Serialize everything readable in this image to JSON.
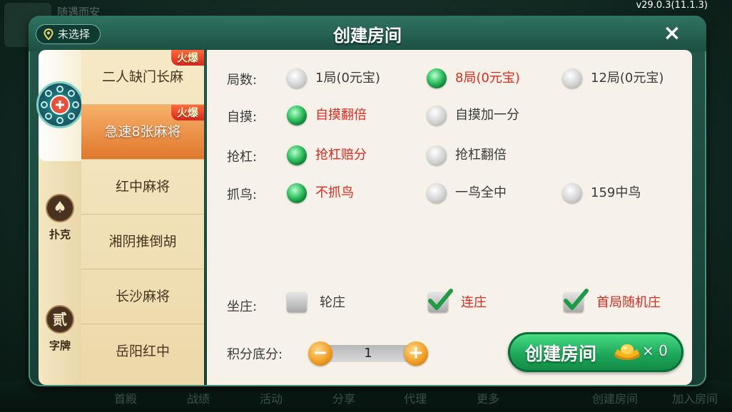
{
  "version": "v29.0.3(11.1.3)",
  "background": {
    "top_text": "随遇而安",
    "bottom_items": [
      "首殿",
      "战绩",
      "活动",
      "分享",
      "代理",
      "更多",
      "创建房间",
      "加入房间"
    ]
  },
  "dialog": {
    "title": "创建房间",
    "location_label": "未选择",
    "close_label": "×"
  },
  "categories": [
    {
      "name": "mahjong",
      "label": "",
      "active": true
    },
    {
      "name": "poker",
      "label": "扑克",
      "glyph": "♠"
    },
    {
      "name": "zipai",
      "label": "字牌",
      "glyph": "贰"
    }
  ],
  "games": [
    {
      "label": "二人缺门长麻",
      "hot": "火爆",
      "selected": false
    },
    {
      "label": "急速8张麻将",
      "hot": "火爆",
      "selected": true
    },
    {
      "label": "红中麻将"
    },
    {
      "label": "湘阴推倒胡"
    },
    {
      "label": "长沙麻将"
    },
    {
      "label": "岳阳红中"
    }
  ],
  "options": {
    "rounds": {
      "label": "局数:",
      "choices": [
        "1局(0元宝)",
        "8局(0元宝)",
        "12局(0元宝)"
      ],
      "selected": 1
    },
    "zimo": {
      "label": "自摸:",
      "choices": [
        "自摸翻倍",
        "自摸加一分"
      ],
      "selected": 0
    },
    "qianggang": {
      "label": "抢杠:",
      "choices": [
        "抢杠赔分",
        "抢杠翻倍"
      ],
      "selected": 0
    },
    "zhuaniao": {
      "label": "抓鸟:",
      "choices": [
        "不抓鸟",
        "一鸟全中",
        "159中鸟"
      ],
      "selected": 0
    },
    "zuozhuang": {
      "label": "坐庄:",
      "choices": [
        "轮庄",
        "连庄",
        "首局随机庄"
      ],
      "checked": [
        false,
        true,
        true
      ]
    }
  },
  "score": {
    "label": "积分底分:",
    "value": "1",
    "minus": "−",
    "plus": "+"
  },
  "create_button": {
    "label": "创建房间",
    "cost": "× 0"
  },
  "colors": {
    "accent_red": "#e02a20",
    "radio_green": "#2fbf5f",
    "button_green": "#1ea75a",
    "frame_green": "#23574a"
  }
}
